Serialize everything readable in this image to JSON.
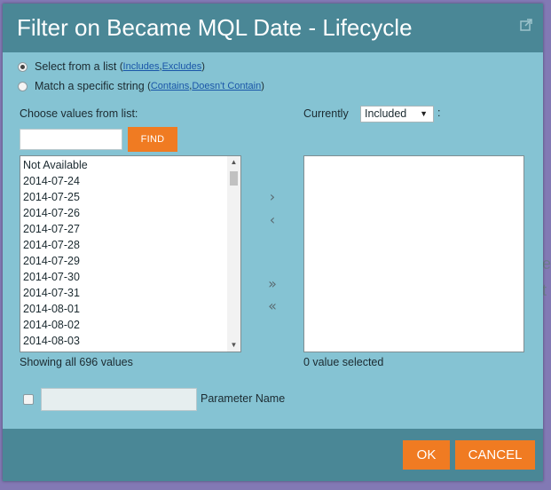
{
  "dialog": {
    "title": "Filter on Became MQL Date - Lifecycle",
    "icon": "popout-icon"
  },
  "mode": {
    "option_list": {
      "label": "Select from a list",
      "open_paren": "(",
      "link_includes": "Includes",
      "separator": ", ",
      "link_excludes": "Excludes",
      "close_paren": ")",
      "checked": true
    },
    "option_string": {
      "label": "Match a specific string",
      "open_paren": "(",
      "link_contains": "Contains",
      "separator": ", ",
      "link_doesnt_contain": "Doesn't Contain",
      "close_paren": ")",
      "checked": false
    }
  },
  "left": {
    "heading": "Choose values from list:",
    "search_value": "",
    "find_label": "FIND",
    "items": [
      "Not Available",
      "2014-07-24",
      "2014-07-25",
      "2014-07-26",
      "2014-07-27",
      "2014-07-28",
      "2014-07-29",
      "2014-07-30",
      "2014-07-31",
      "2014-08-01",
      "2014-08-02",
      "2014-08-03"
    ],
    "status": "Showing all 696 values"
  },
  "right": {
    "heading": "Currently",
    "select_value": "Included",
    "colon": ":",
    "status": "0 value selected"
  },
  "transfer": {
    "add_one": "›",
    "remove_one": "‹",
    "add_all": "»",
    "remove_all": "«"
  },
  "parameter": {
    "value": "",
    "label": "Parameter Name"
  },
  "footer": {
    "ok_label": "OK",
    "cancel_label": "CANCEL"
  },
  "colors": {
    "dialog_bg": "#85c3d3",
    "header_bg": "#4a8796",
    "accent": "#f07b22",
    "link": "#1a56a8"
  }
}
